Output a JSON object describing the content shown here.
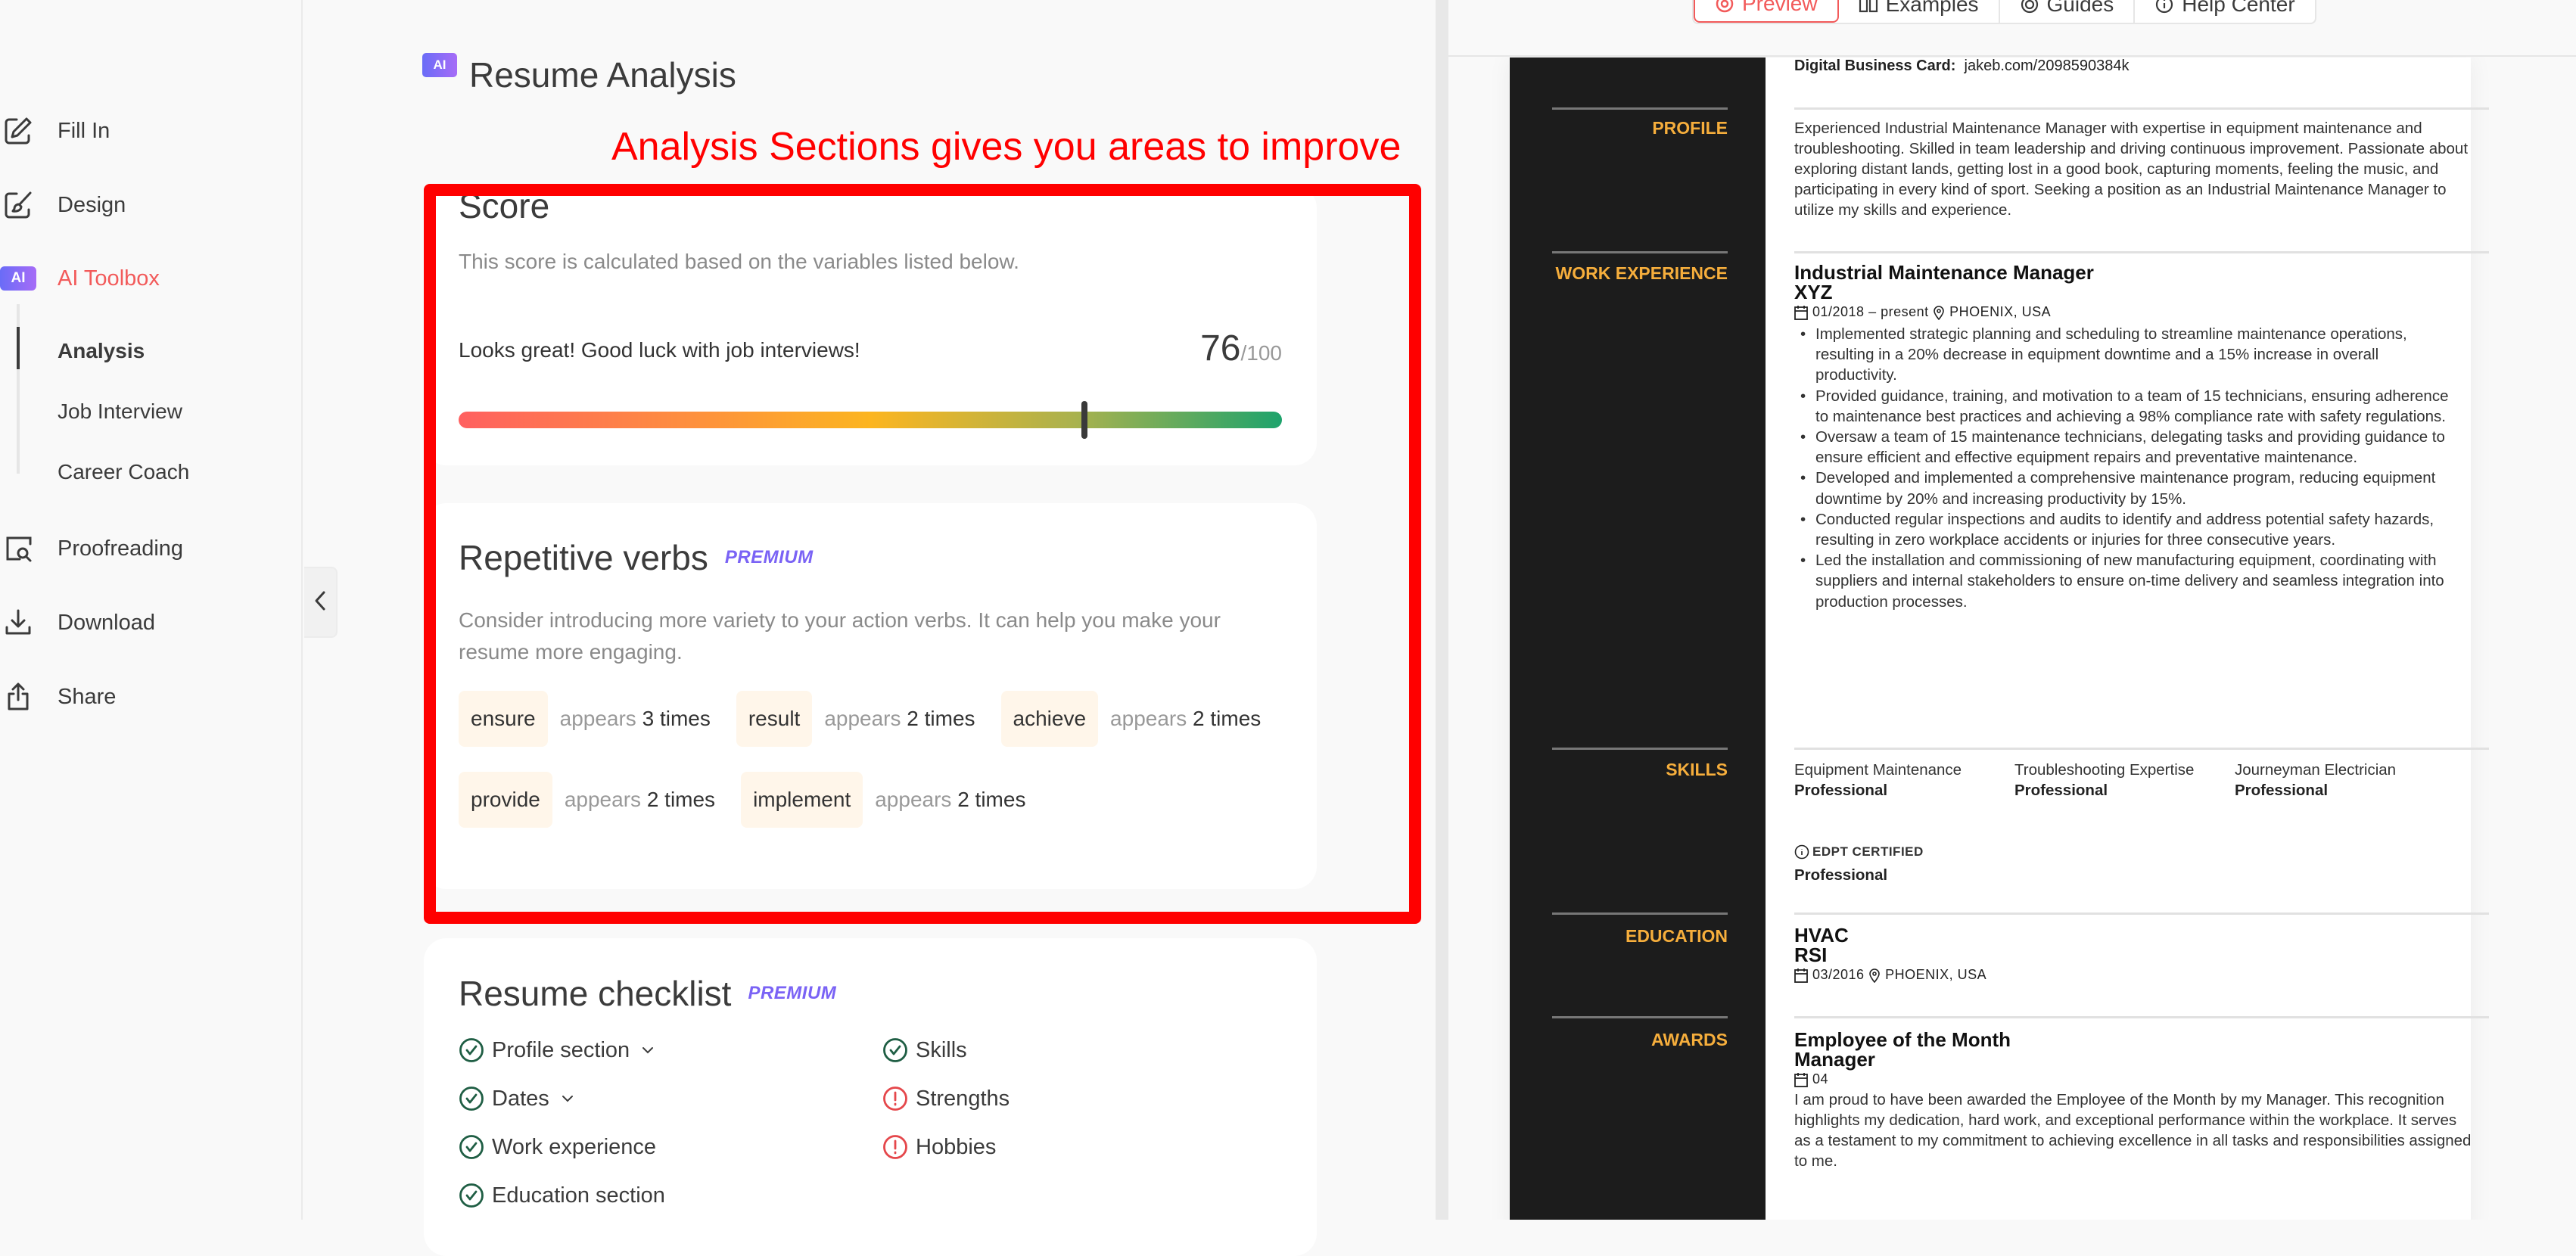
{
  "sidebar": {
    "items": [
      {
        "label": "Fill In",
        "icon": "edit-pencil-icon"
      },
      {
        "label": "Design",
        "icon": "design-brush-icon"
      },
      {
        "label": "AI Toolbox",
        "icon": "ai-badge",
        "badge": "AI",
        "active": true
      },
      {
        "label": "Proofreading",
        "icon": "proofread-search-icon"
      },
      {
        "label": "Download",
        "icon": "download-icon"
      },
      {
        "label": "Share",
        "icon": "share-icon"
      }
    ],
    "subitems": [
      {
        "label": "Analysis",
        "active": true
      },
      {
        "label": "Job Interview"
      },
      {
        "label": "Career Coach"
      }
    ],
    "collapse_icon": "chevron-left-icon"
  },
  "main": {
    "badge": "AI",
    "title": "Resume Analysis",
    "annotation": "Analysis Sections gives you areas to improve",
    "score_card": {
      "title": "Score",
      "description": "This score is calculated based on the variables listed below.",
      "message": "Looks great! Good luck with job interviews!",
      "score": "76",
      "max": "/100",
      "score_fraction": 0.76
    },
    "verbs_card": {
      "title": "Repetitive verbs",
      "premium": "PREMIUM",
      "description": "Consider introducing more variety to your action verbs. It can help you make your resume more engaging.",
      "appears_label": "appears",
      "verbs": [
        {
          "word": "ensure",
          "count": "3 times"
        },
        {
          "word": "result",
          "count": "2 times"
        },
        {
          "word": "achieve",
          "count": "2 times"
        },
        {
          "word": "provide",
          "count": "2 times"
        },
        {
          "word": "implement",
          "count": "2 times"
        }
      ]
    },
    "checklist_card": {
      "title": "Resume checklist",
      "premium": "PREMIUM",
      "items_left": [
        {
          "label": "Profile section",
          "status": "ok",
          "expandable": true
        },
        {
          "label": "Dates",
          "status": "ok",
          "expandable": true
        },
        {
          "label": "Work experience",
          "status": "ok"
        },
        {
          "label": "Education section",
          "status": "ok"
        }
      ],
      "items_right": [
        {
          "label": "Skills",
          "status": "ok"
        },
        {
          "label": "Strengths",
          "status": "warning"
        },
        {
          "label": "Hobbies",
          "status": "warning"
        }
      ]
    }
  },
  "preview": {
    "tabs": [
      {
        "label": "Preview",
        "icon": "preview-eye-icon",
        "active": true
      },
      {
        "label": "Examples",
        "icon": "book-icon"
      },
      {
        "label": "Guides",
        "icon": "target-icon"
      },
      {
        "label": "Help Center",
        "icon": "help-info-icon"
      }
    ],
    "resume": {
      "business_card_label": "Digital Business Card:",
      "business_card_value": "jakeb.com/2098590384k",
      "sections": {
        "profile": "PROFILE",
        "work": "WORK EXPERIENCE",
        "skills": "SKILLS",
        "education": "EDUCATION",
        "awards": "AWARDS"
      },
      "profile_text": "Experienced Industrial Maintenance Manager with expertise in equipment maintenance and troubleshooting. Skilled in team leadership and driving continuous improvement. Passionate about exploring distant lands, getting lost in a good book, capturing moments, feeling the music, and participating in every kind of sport. Seeking a position as an Industrial Maintenance Manager to utilize my skills and experience.",
      "job": {
        "title": "Industrial Maintenance Manager",
        "company": "XYZ",
        "dates": "01/2018 – present",
        "location": "PHOENIX, USA",
        "bullets": [
          "Implemented strategic planning and scheduling to streamline maintenance operations, resulting in a 20% decrease in equipment downtime and a 15% increase in overall productivity.",
          "Provided guidance, training, and motivation to a team of 15 technicians, ensuring adherence to maintenance best practices and achieving a 98% compliance rate with safety regulations.",
          "Oversaw a team of 15 maintenance technicians, delegating tasks and providing guidance to ensure efficient and effective equipment repairs and preventative maintenance.",
          "Developed and implemented a comprehensive maintenance program, reducing equipment downtime by 20% and increasing productivity by 15%.",
          "Conducted regular inspections and audits to identify and address potential safety hazards, resulting in zero workplace accidents or injuries for three consecutive years.",
          "Led the installation and commissioning of new manufacturing equipment, coordinating with suppliers and internal stakeholders to ensure on-time delivery and seamless integration into production processes."
        ]
      },
      "skills": [
        {
          "name": "Equipment Maintenance",
          "level": "Professional"
        },
        {
          "name": "Troubleshooting Expertise",
          "level": "Professional"
        },
        {
          "name": "Journeyman Electrician",
          "level": "Professional"
        }
      ],
      "certification": {
        "name": "EDPT CERTIFIED",
        "level": "Professional"
      },
      "education": {
        "degree": "HVAC",
        "school": "RSI",
        "date": "03/2016",
        "location": "PHOENIX, USA"
      },
      "award": {
        "title": "Employee of the Month",
        "issuer": "Manager",
        "date": "04",
        "description": "I am proud to have been awarded the Employee of the Month by my Manager. This recognition highlights my dedication, hard work, and exceptional performance within the workplace. It serves as a testament to my commitment to achieving excellence in all tasks and responsibilities assigned to me."
      }
    }
  },
  "colors": {
    "accent": "#f25a5a",
    "premium": "#7a63f5",
    "ok": "#1f5e44",
    "warning": "#e5474b",
    "resume_accent": "#f6ae3c",
    "annotation": "#ff0000"
  }
}
